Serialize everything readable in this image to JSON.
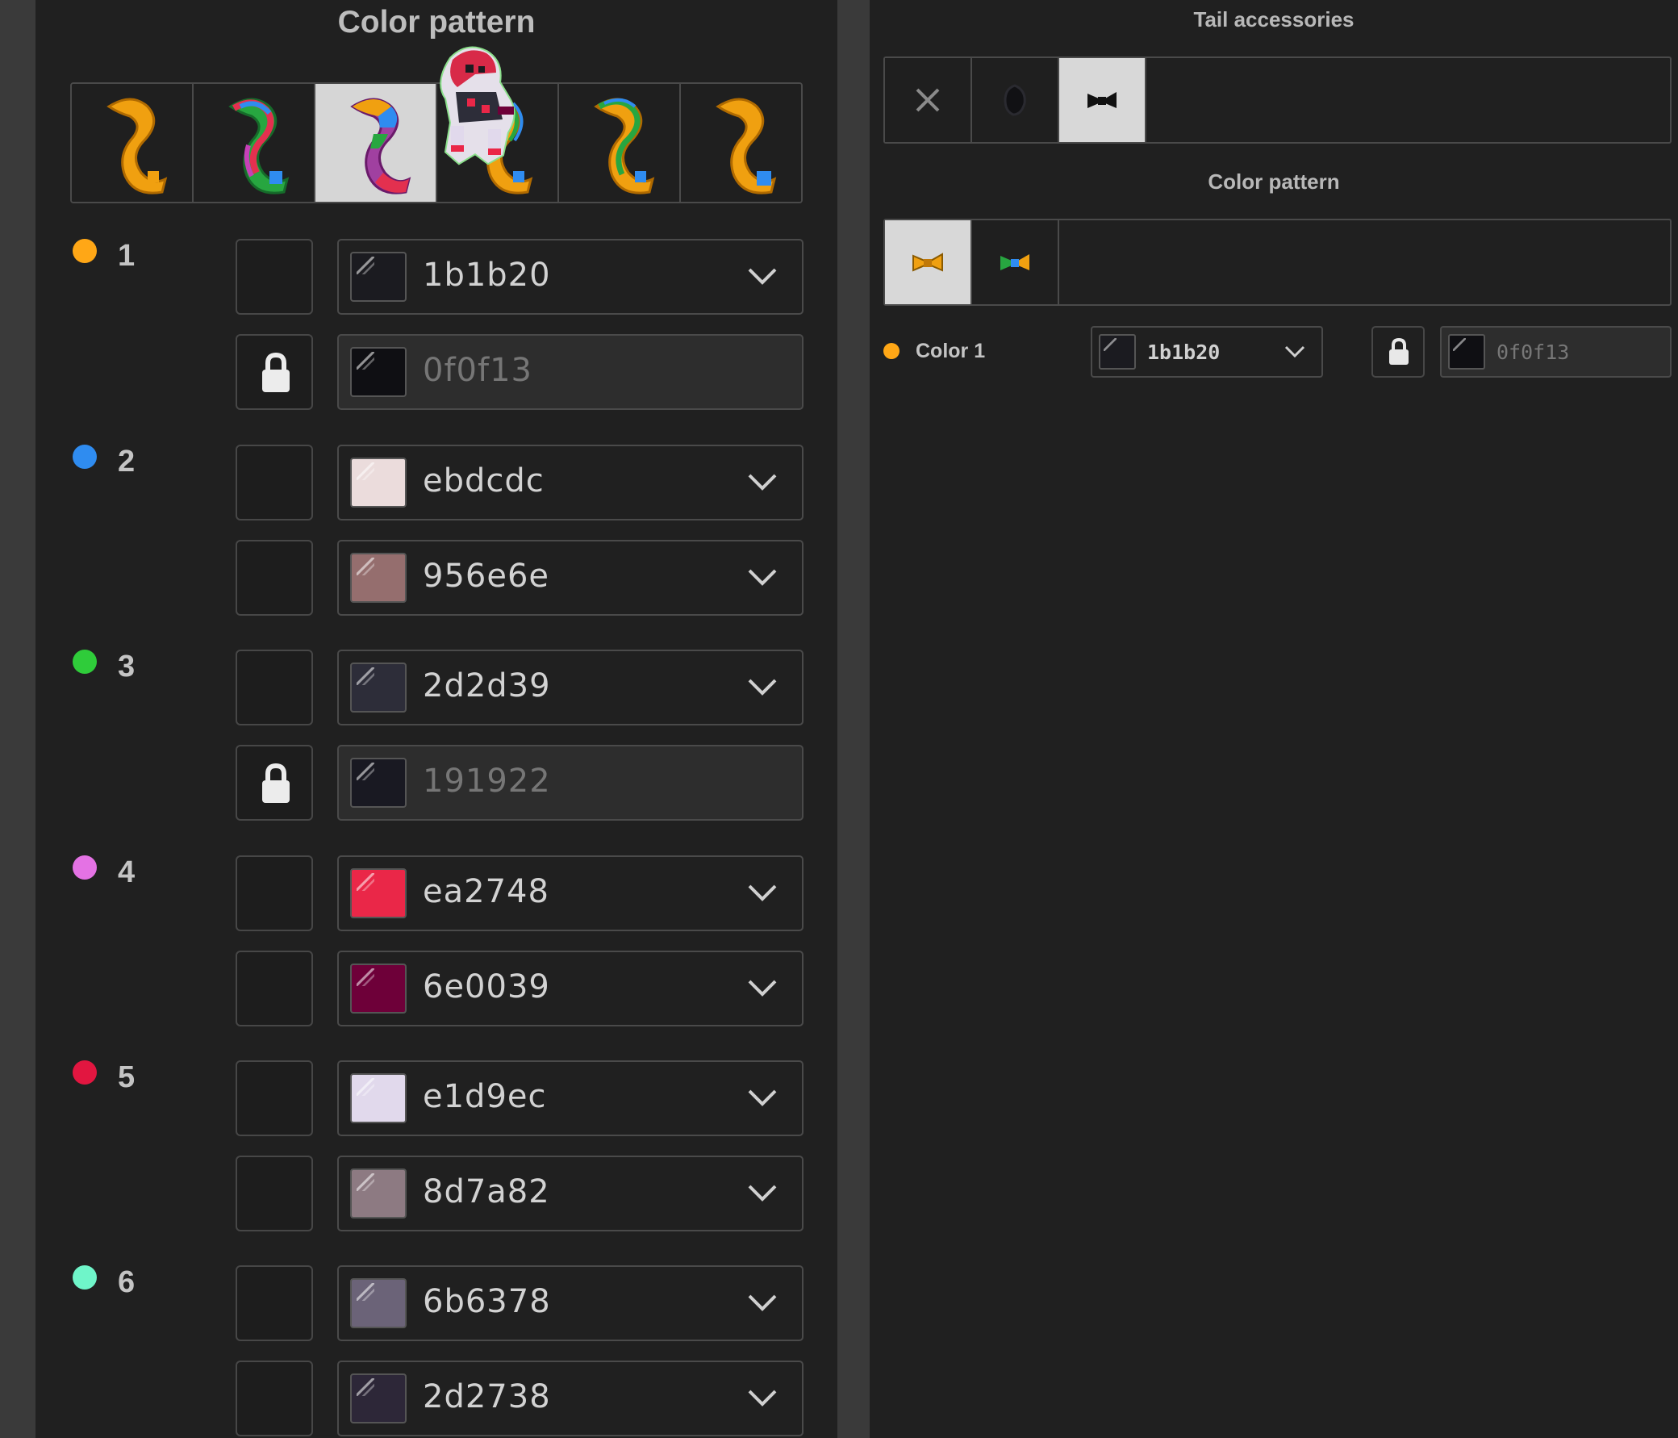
{
  "left": {
    "title": "Color pattern",
    "thumbnails": [
      {
        "name": "pattern-plain-orange",
        "selected": false
      },
      {
        "name": "pattern-rainbow-stripes",
        "selected": false
      },
      {
        "name": "pattern-rainbow-tip",
        "selected": true
      },
      {
        "name": "pattern-orange-rainbow-edge",
        "selected": false
      },
      {
        "name": "pattern-orange-green-stripe",
        "selected": false
      },
      {
        "name": "pattern-orange-blue-tip",
        "selected": false
      }
    ],
    "colors": [
      {
        "number": "1",
        "dot_color": "#ffa716",
        "primary": {
          "hex": "1b1b20",
          "swatch": "#1b1b20",
          "locked": false
        },
        "secondary": {
          "hex": "0f0f13",
          "swatch": "#0f0f13",
          "locked": true
        }
      },
      {
        "number": "2",
        "dot_color": "#2f8cf0",
        "primary": {
          "hex": "ebdcdc",
          "swatch": "#ebdcdc",
          "locked": false
        },
        "secondary": {
          "hex": "956e6e",
          "swatch": "#956e6e",
          "locked": false
        }
      },
      {
        "number": "3",
        "dot_color": "#2fcc3a",
        "primary": {
          "hex": "2d2d39",
          "swatch": "#2d2d39",
          "locked": false
        },
        "secondary": {
          "hex": "191922",
          "swatch": "#191922",
          "locked": true
        }
      },
      {
        "number": "4",
        "dot_color": "#e472e4",
        "primary": {
          "hex": "ea2748",
          "swatch": "#ea2748",
          "locked": false
        },
        "secondary": {
          "hex": "6e0039",
          "swatch": "#6e0039",
          "locked": false
        }
      },
      {
        "number": "5",
        "dot_color": "#e21640",
        "primary": {
          "hex": "e1d9ec",
          "swatch": "#e1d9ec",
          "locked": false
        },
        "secondary": {
          "hex": "8d7a82",
          "swatch": "#8d7a82",
          "locked": false
        }
      },
      {
        "number": "6",
        "dot_color": "#6ff5c9",
        "primary": {
          "hex": "6b6378",
          "swatch": "#6b6378",
          "locked": false
        },
        "secondary": {
          "hex": "2d2738",
          "swatch": "#2d2738",
          "locked": false
        }
      }
    ]
  },
  "right": {
    "accessories_title": "Tail accessories",
    "accessories": [
      {
        "name": "none",
        "selected": false
      },
      {
        "name": "dark-accessory",
        "selected": false
      },
      {
        "name": "bow-accessory",
        "selected": true
      }
    ],
    "pattern_title": "Color pattern",
    "patterns": [
      {
        "name": "pattern-orange-bow",
        "selected": true
      },
      {
        "name": "pattern-multicolor-bow",
        "selected": false
      }
    ],
    "color1": {
      "label": "Color 1",
      "dot_color": "#ffa716",
      "hex": "1b1b20",
      "swatch": "#1b1b20",
      "locked_hex": "0f0f13",
      "locked_swatch": "#0f0f13"
    }
  }
}
